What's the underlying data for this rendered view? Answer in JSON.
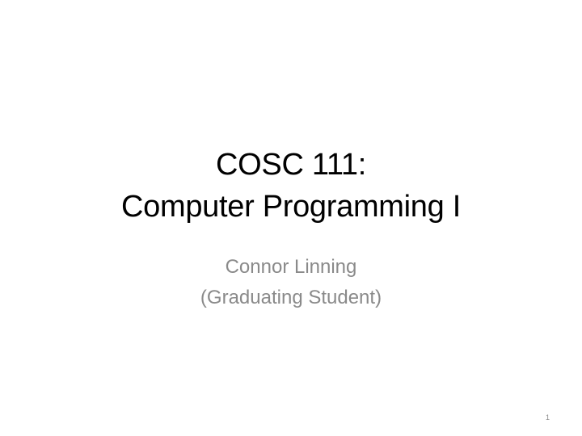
{
  "slide": {
    "title_line1": "COSC 111:",
    "title_line2": "Computer Programming I",
    "subtitle_line1": "Connor Linning",
    "subtitle_line2": "(Graduating Student)",
    "page_number": "1"
  },
  "colors": {
    "background": "#ffffff",
    "title": "#000000",
    "subtitle": "#8a8a8a"
  }
}
